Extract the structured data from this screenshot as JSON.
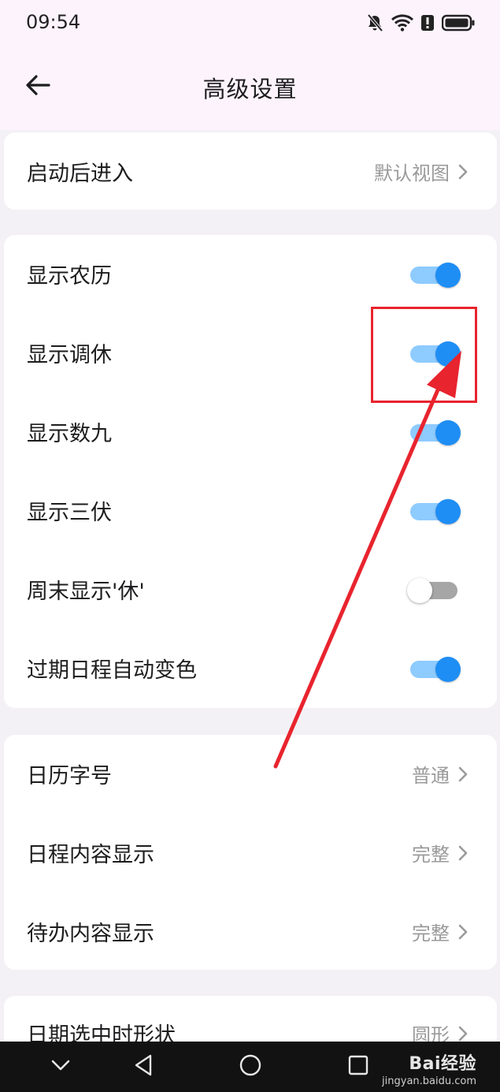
{
  "status_bar": {
    "time": "09:54",
    "icons": [
      "bell-muted-icon",
      "wifi-icon",
      "alert-icon",
      "battery-icon"
    ]
  },
  "header": {
    "title": "高级设置",
    "back_icon": "arrow-left-icon"
  },
  "groups": {
    "startup": {
      "label": "启动后进入",
      "value": "默认视图"
    },
    "display": {
      "items": [
        {
          "label": "显示农历",
          "on": true
        },
        {
          "label": "显示调休",
          "on": true
        },
        {
          "label": "显示数九",
          "on": true
        },
        {
          "label": "显示三伏",
          "on": true
        },
        {
          "label": "周末显示'休'",
          "on": false
        },
        {
          "label": "过期日程自动变色",
          "on": true
        }
      ]
    },
    "content": {
      "items": [
        {
          "label": "日历字号",
          "value": "普通"
        },
        {
          "label": "日程内容显示",
          "value": "完整"
        },
        {
          "label": "待办内容显示",
          "value": "完整"
        }
      ]
    },
    "shape": {
      "label": "日期选中时形状",
      "value": "圆形"
    }
  },
  "annotation": {
    "box_color": "#e8242e",
    "arrow_color": "#e8242e",
    "target": "显示调休"
  },
  "nav_bar": {
    "buttons": [
      "chevron-down-icon",
      "back-triangle-icon",
      "home-circle-icon",
      "recents-square-icon"
    ]
  },
  "watermark": {
    "logo": "Bai经验",
    "url": "jingyan.baidu.com"
  },
  "colors": {
    "toggle_on_knob": "#1e8ef5",
    "toggle_on_track": "#8ecbff",
    "toggle_off_track": "#a6a6a6",
    "header_bg": "#fcf3fc",
    "page_bg": "#f3f1f5"
  }
}
